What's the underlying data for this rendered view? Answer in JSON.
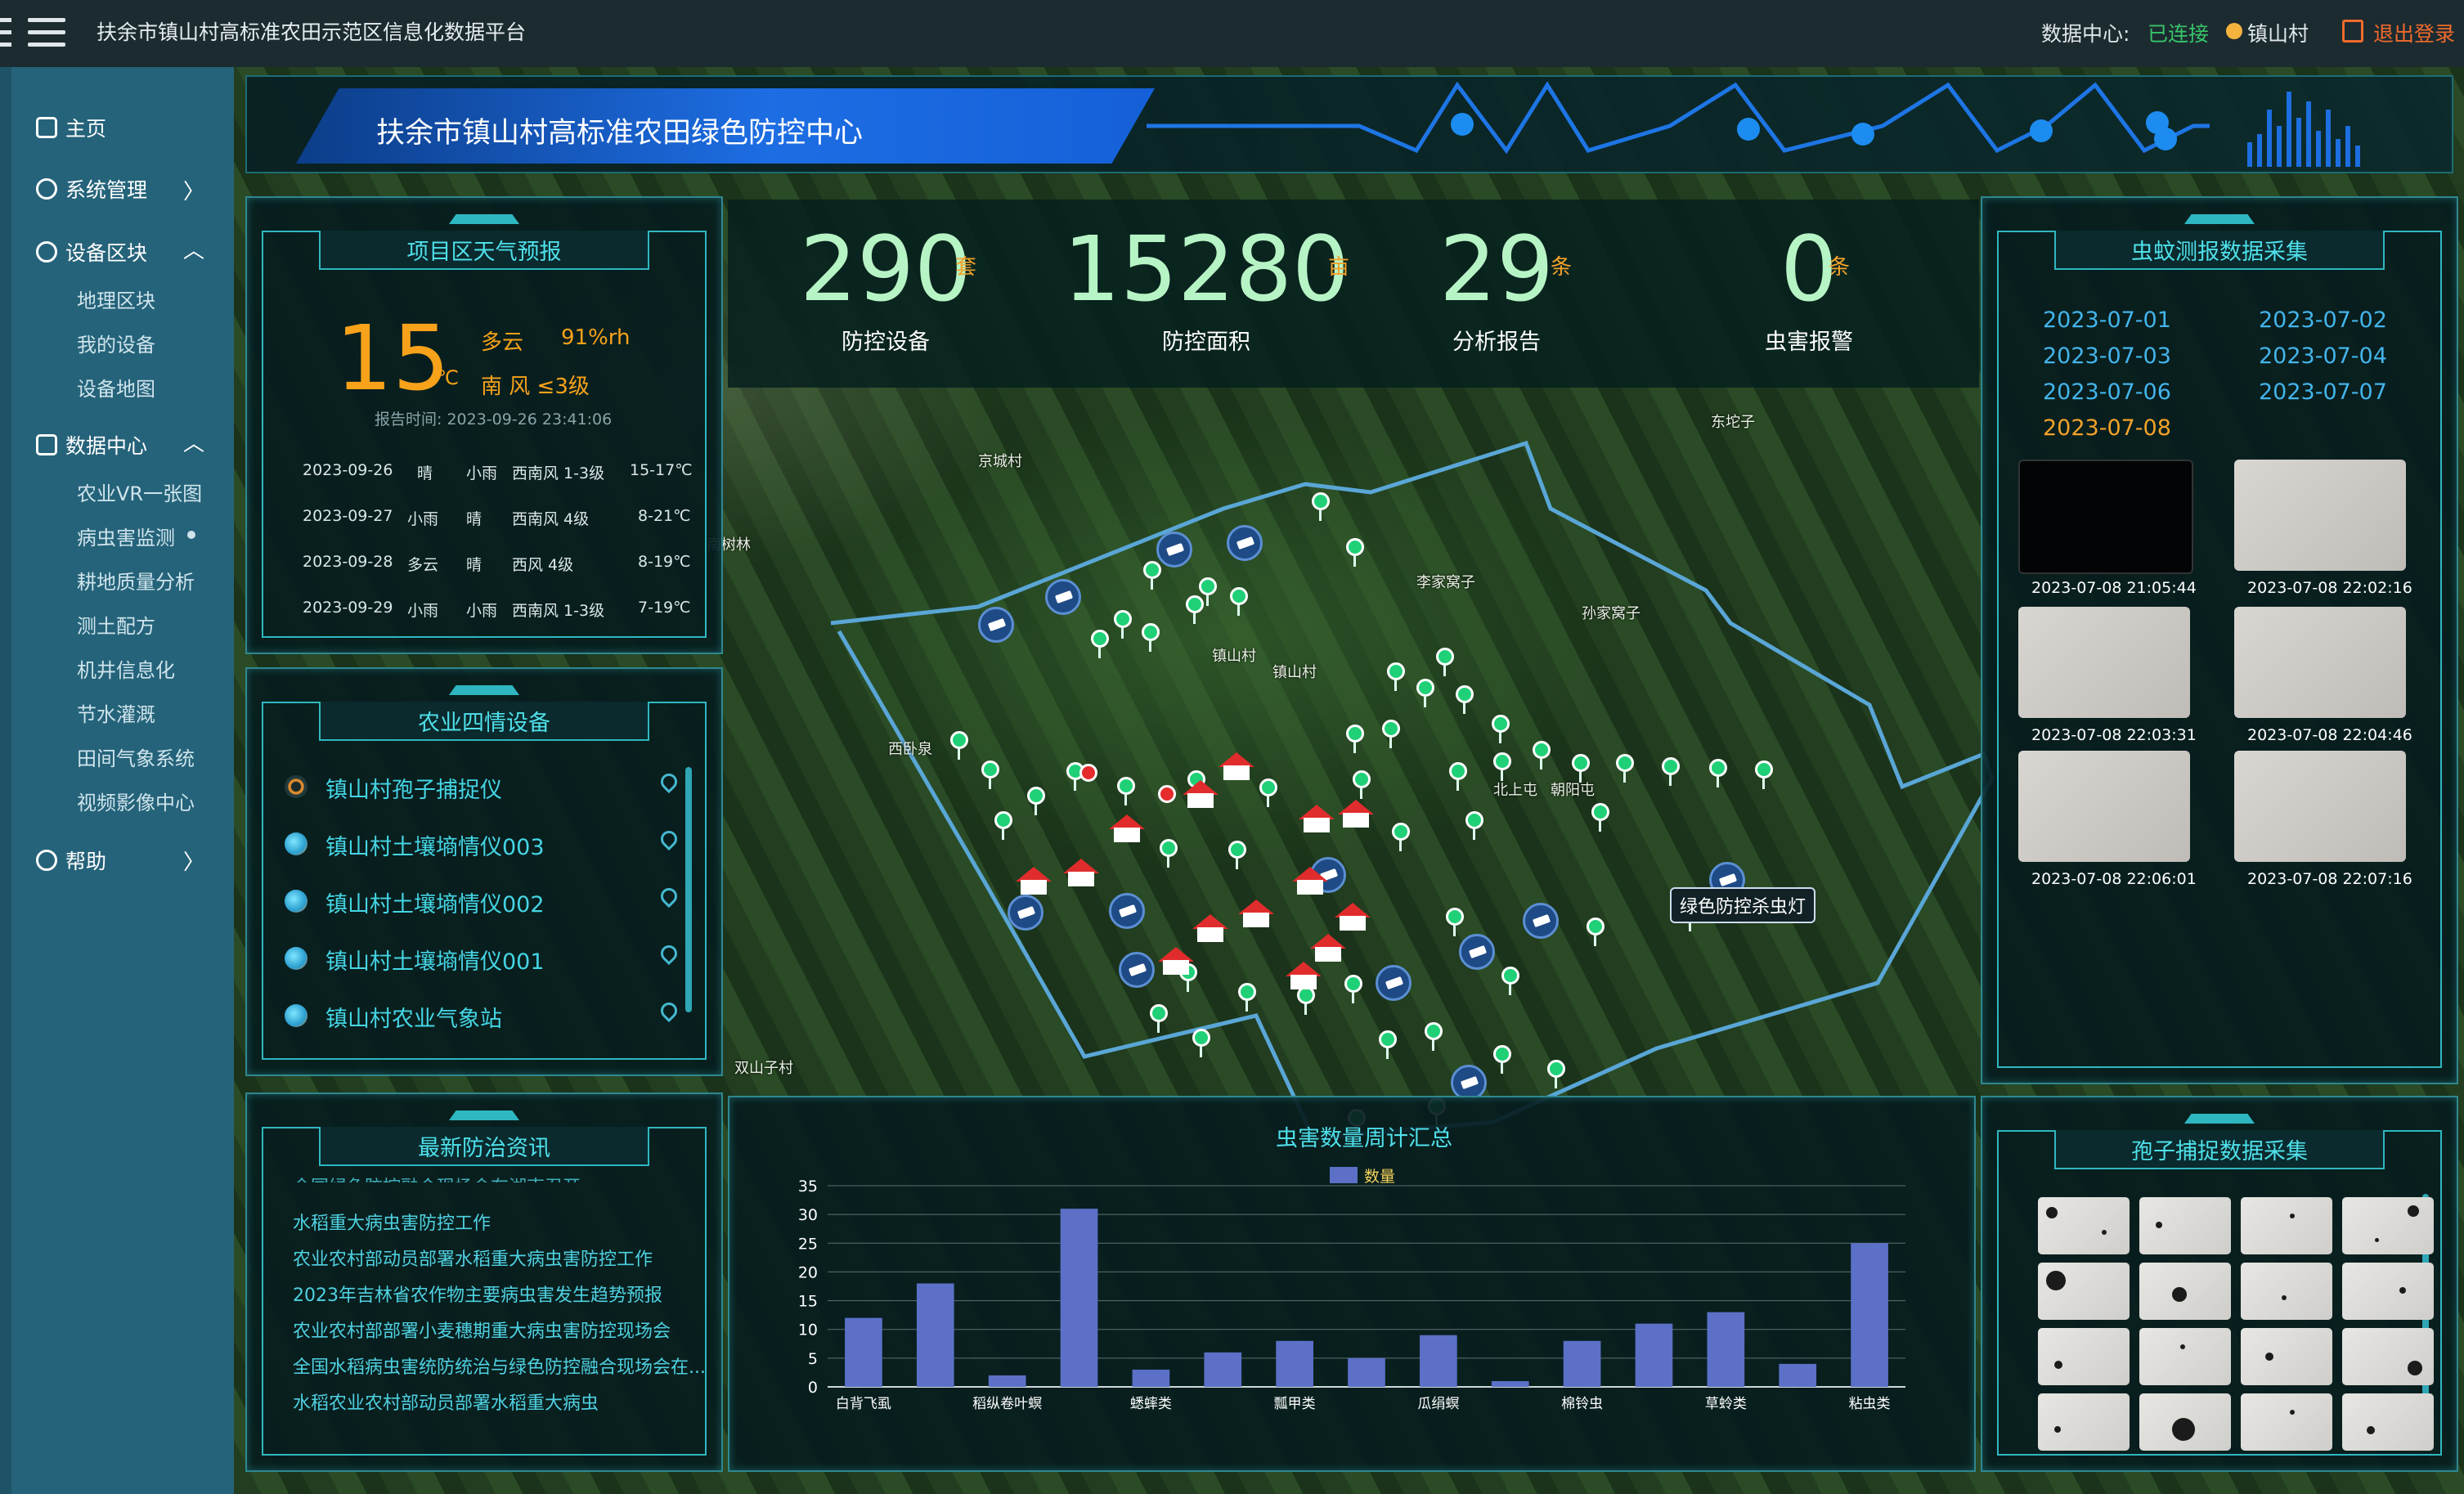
{
  "topbar": {
    "app_title": "扶余市镇山村高标准农田示范区信息化数据平台",
    "data_center_label": "数据中心:",
    "data_center_status": "已连接",
    "user_name": "镇山村",
    "logout": "退出登录"
  },
  "sidebar": {
    "home": "主页",
    "system": "系统管理",
    "blocks": "设备区块",
    "blocks_items": [
      "地理区块",
      "我的设备",
      "设备地图"
    ],
    "data_center": "数据中心",
    "data_items": [
      "农业VR一张图",
      "病虫害监测",
      "耕地质量分析",
      "测土配方",
      "机井信息化",
      "节水灌溉",
      "田间气象系统",
      "视频影像中心"
    ],
    "help": "帮助",
    "chev_right": "〉",
    "chev_up": "︿"
  },
  "header": {
    "title": "扶余市镇山村高标准农田绿色防控中心"
  },
  "stats": [
    {
      "value": "290",
      "unit": "套",
      "label": "防控设备"
    },
    {
      "value": "15280",
      "unit": "亩",
      "label": "防控面积"
    },
    {
      "value": "29",
      "unit": "条",
      "label": "分析报告"
    },
    {
      "value": "0",
      "unit": "条",
      "label": "虫害报警"
    }
  ],
  "weather": {
    "title": "项目区天气预报",
    "temp": "15",
    "unit": "℃",
    "condition": "多云",
    "humidity": "91%rh",
    "wind": "南 风 ≤3级",
    "report_time": "报告时间: 2023-09-26 23:41:06",
    "forecast": [
      {
        "date": "2023-09-26",
        "day": "晴",
        "night": "小雨",
        "wind": "西南风 1-3级",
        "temp": "15-17℃"
      },
      {
        "date": "2023-09-27",
        "day": "小雨",
        "night": "晴",
        "wind": "西南风 4级",
        "temp": "8-21℃"
      },
      {
        "date": "2023-09-28",
        "day": "多云",
        "night": "晴",
        "wind": "西风 4级",
        "temp": "8-19℃"
      },
      {
        "date": "2023-09-29",
        "day": "小雨",
        "night": "小雨",
        "wind": "西南风 1-3级",
        "temp": "7-19℃"
      }
    ]
  },
  "devices": {
    "title": "农业四情设备",
    "items": [
      "镇山村孢子捕捉仪",
      "镇山村土壤墒情仪003",
      "镇山村土壤墒情仪002",
      "镇山村土壤墒情仪001",
      "镇山村农业气象站"
    ]
  },
  "news": {
    "title": "最新防治资讯",
    "partial_top": "全国绿色防控融合现场会在湖南召开",
    "items": [
      "水稻重大病虫害防控工作",
      "农业农村部动员部署水稻重大病虫害防控工作",
      "2023年吉林省农作物主要病虫害发生趋势预报",
      "农业农村部部署小麦穗期重大病虫害防控现场会",
      "全国水稻病虫害统防统治与绿色防控融合现场会在...",
      "水稻农业农村部动员部署水稻重大病虫"
    ]
  },
  "insect": {
    "title": "虫蚊测报数据采集",
    "dates": [
      "2023-07-01",
      "2023-07-02",
      "2023-07-03",
      "2023-07-04",
      "2023-07-06",
      "2023-07-07",
      "2023-07-08"
    ],
    "thumbs": [
      "2023-07-08 21:05:44",
      "2023-07-08 22:02:16",
      "2023-07-08 22:03:31",
      "2023-07-08 22:04:46",
      "2023-07-08 22:06:01",
      "2023-07-08 22:07:16"
    ]
  },
  "spore": {
    "title": "孢子捕捉数据采集"
  },
  "map": {
    "lamp_label": "绿色防控杀虫灯",
    "places": [
      "京城村",
      "镇山村",
      "李家窝子",
      "孙家窝子",
      "东坨子",
      "双山子村",
      "西卧泉",
      "朝阳屯",
      "北上屯",
      "南树林",
      "镇山村"
    ]
  },
  "chart_data": {
    "type": "bar",
    "title": "虫害数量周计汇总",
    "legend": "数量",
    "categories": [
      "白背飞虱",
      "",
      "稻纵卷叶螟",
      "",
      "蟋蟀类",
      "",
      "瓢甲类",
      "",
      "瓜绢螟",
      "",
      "棉铃虫",
      "",
      "草蛉类",
      "",
      "粘虫类"
    ],
    "values": [
      12,
      18,
      2,
      31,
      3,
      6,
      8,
      5,
      9,
      1,
      8,
      11,
      13,
      4,
      25
    ],
    "ylim": [
      0,
      35
    ],
    "yticks": [
      0,
      5,
      10,
      15,
      20,
      25,
      30,
      35
    ],
    "bar_color": "#5b70c6"
  }
}
